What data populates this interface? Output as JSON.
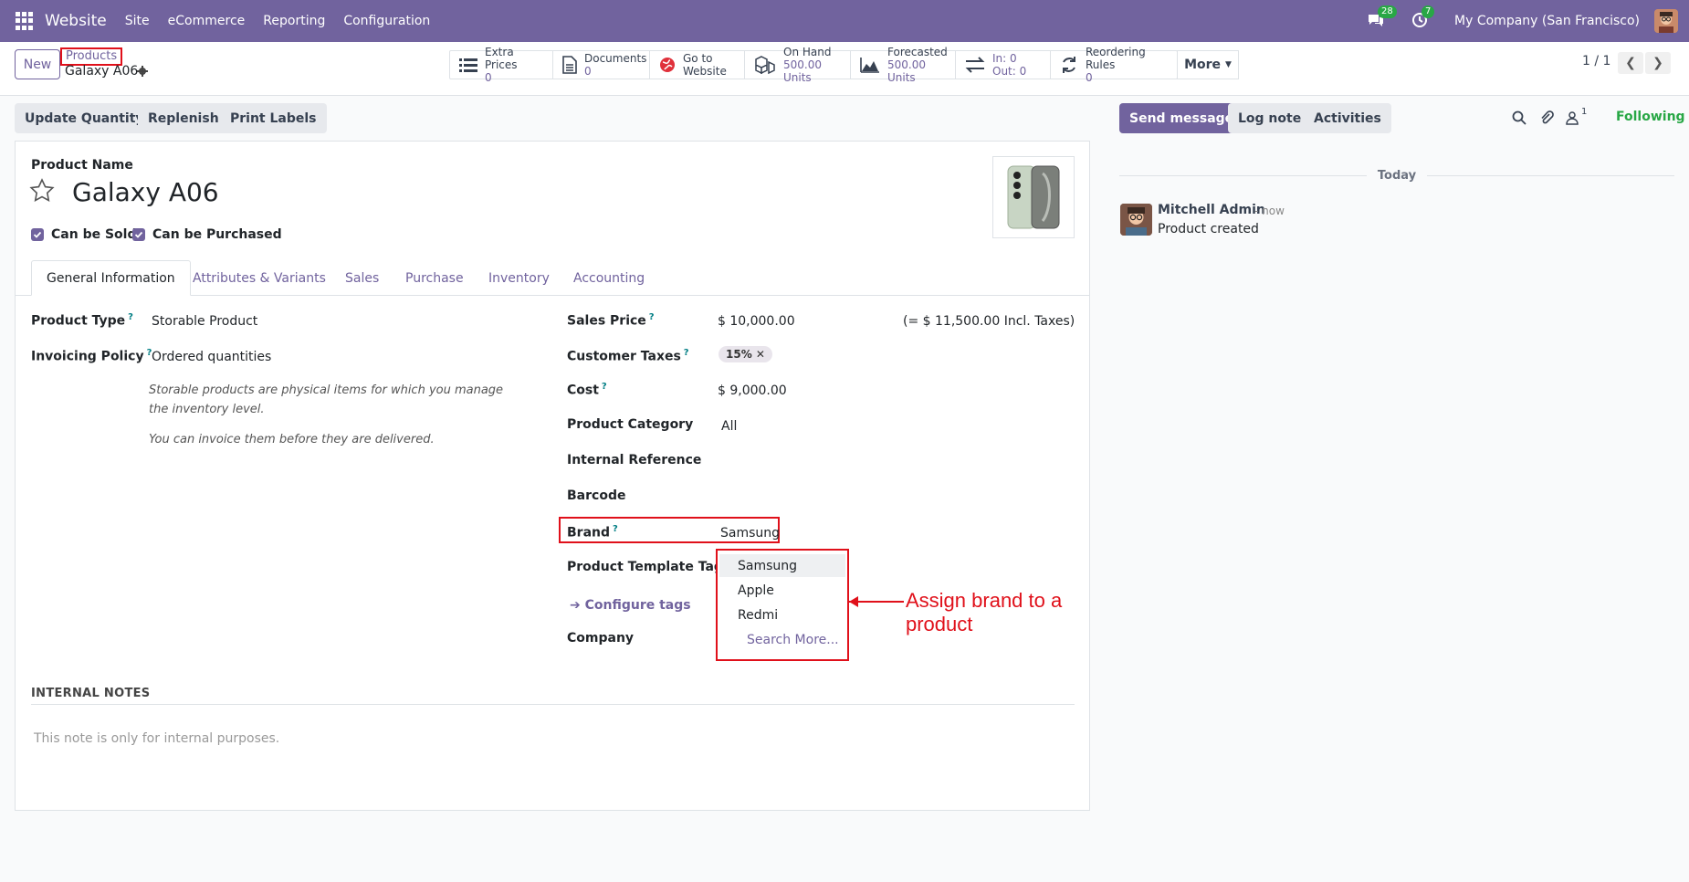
{
  "topbar": {
    "app_name": "Website",
    "menu": [
      "Site",
      "eCommerce",
      "Reporting",
      "Configuration"
    ],
    "messages_count": "28",
    "activities_count": "7",
    "company": "My Company (San Francisco)"
  },
  "control_panel": {
    "new_label": "New",
    "breadcrumb_parent": "Products",
    "breadcrumb_current": "Galaxy A06",
    "smart_buttons": [
      {
        "label": "Extra Prices",
        "value": "0"
      },
      {
        "label": "Documents",
        "value": "0"
      },
      {
        "label": "Go to",
        "value": "Website"
      },
      {
        "label": "On Hand",
        "value": "500.00 Units"
      },
      {
        "label": "Forecasted",
        "value": "500.00 Units"
      },
      {
        "label": "In: 0",
        "value": "Out: 0"
      },
      {
        "label": "Reordering Rules",
        "value": "0"
      }
    ],
    "more_label": "More",
    "pager": "1 / 1"
  },
  "actions": {
    "update_quantity": "Update Quantity",
    "replenish": "Replenish",
    "print_labels": "Print Labels"
  },
  "chatter": {
    "send_message": "Send message",
    "log_note": "Log note",
    "activities": "Activities",
    "followers_count": "1",
    "following": "Following",
    "today": "Today",
    "message": {
      "author": "Mitchell Admin",
      "time": "- now",
      "body": "Product created"
    }
  },
  "form": {
    "product_name_label": "Product Name",
    "product_name": "Galaxy A06",
    "can_be_sold": "Can be Sold",
    "can_be_purchased": "Can be Purchased",
    "tabs": [
      "General Information",
      "Attributes & Variants",
      "Sales",
      "Purchase",
      "Inventory",
      "Accounting"
    ],
    "product_type_label": "Product Type",
    "product_type": "Storable Product",
    "invoicing_policy_label": "Invoicing Policy",
    "invoicing_policy": "Ordered quantities",
    "desc_1": "Storable products are physical items for which you manage the inventory level.",
    "desc_2": "You can invoice them before they are delivered.",
    "sales_price_label": "Sales Price",
    "sales_price": "$ 10,000.00",
    "sales_price_incl": "(= $ 11,500.00 Incl. Taxes)",
    "customer_taxes_label": "Customer Taxes",
    "customer_tax_tag": "15%",
    "cost_label": "Cost",
    "cost": "$ 9,000.00",
    "product_category_label": "Product Category",
    "product_category": "All",
    "internal_reference_label": "Internal Reference",
    "barcode_label": "Barcode",
    "brand_label": "Brand",
    "brand_value": "Samsung",
    "product_template_tags_label": "Product Template Tags",
    "configure_tags": "Configure tags",
    "company_label": "Company",
    "brand_options": [
      "Samsung",
      "Apple",
      "Redmi"
    ],
    "search_more": "Search More...",
    "internal_notes_title": "INTERNAL NOTES",
    "internal_notes_placeholder": "This note is only for internal purposes."
  },
  "annotation": {
    "text": "Assign brand to a product",
    "color": "#e0101a"
  }
}
